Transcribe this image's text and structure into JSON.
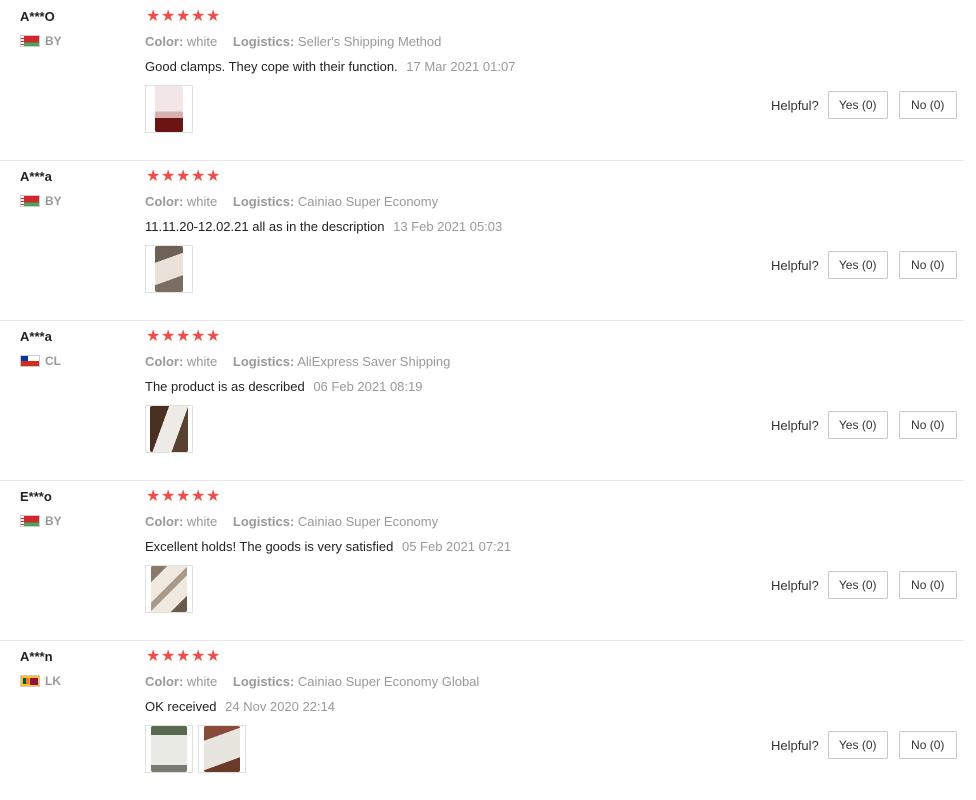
{
  "helpful_label": "Helpful?",
  "reviews": [
    {
      "user": "A***O",
      "country": "BY",
      "flag": "flag-by",
      "color_label": "Color:",
      "color_value": "white",
      "logistics_label": "Logistics:",
      "logistics_value": "Seller's Shipping Method",
      "text": "Good clamps. They cope with their function.",
      "date": "17 Mar 2021 01:07",
      "yes": "Yes (0)",
      "no": "No (0)"
    },
    {
      "user": "A***a",
      "country": "BY",
      "flag": "flag-by",
      "color_label": "Color:",
      "color_value": "white",
      "logistics_label": "Logistics:",
      "logistics_value": "Cainiao Super Economy",
      "text": "11.11.20-12.02.21 all as in the description",
      "date": "13 Feb 2021 05:03",
      "yes": "Yes (0)",
      "no": "No (0)"
    },
    {
      "user": "A***a",
      "country": "CL",
      "flag": "flag-cl",
      "color_label": "Color:",
      "color_value": "white",
      "logistics_label": "Logistics:",
      "logistics_value": "AliExpress Saver Shipping",
      "text": "The product is as described",
      "date": "06 Feb 2021 08:19",
      "yes": "Yes (0)",
      "no": "No (0)"
    },
    {
      "user": "E***o",
      "country": "BY",
      "flag": "flag-by",
      "color_label": "Color:",
      "color_value": "white",
      "logistics_label": "Logistics:",
      "logistics_value": "Cainiao Super Economy",
      "text": "Excellent holds! The goods is very satisfied",
      "date": "05 Feb 2021 07:21",
      "yes": "Yes (0)",
      "no": "No (0)"
    },
    {
      "user": "A***n",
      "country": "LK",
      "flag": "flag-lk",
      "color_label": "Color:",
      "color_value": "white",
      "logistics_label": "Logistics:",
      "logistics_value": "Cainiao Super Economy Global",
      "text": "OK received",
      "date": "24 Nov 2020 22:14",
      "yes": "Yes (0)",
      "no": "No (0)"
    }
  ],
  "rating_stars": 5,
  "star_color": "#f04c4c"
}
